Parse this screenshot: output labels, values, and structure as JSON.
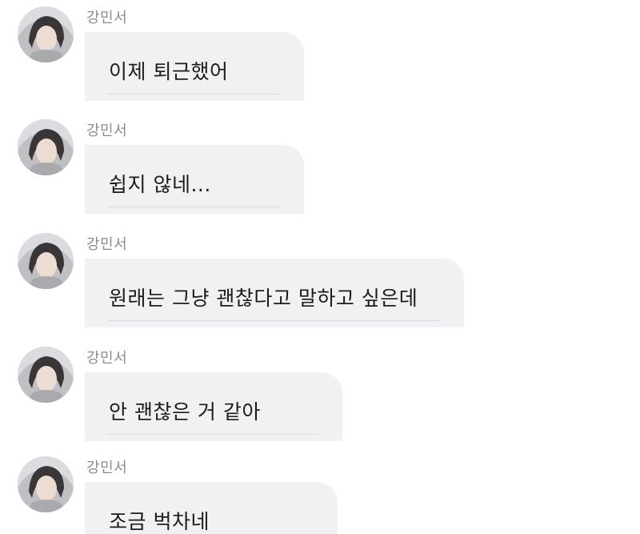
{
  "messages": [
    {
      "sender": "강민서",
      "text": "이제 퇴근했어"
    },
    {
      "sender": "강민서",
      "text": "쉽지 않네..."
    },
    {
      "sender": "강민서",
      "text": "원래는 그냥 괜찮다고 말하고 싶은데"
    },
    {
      "sender": "강민서",
      "text": "안 괜찮은 거 같아"
    },
    {
      "sender": "강민서",
      "text": "조금 벅차네"
    }
  ],
  "colors": {
    "background": "#ffffff",
    "bubble": "#f1f1f3",
    "sender_name": "#8b8b90",
    "message_text": "#1c1c1e"
  }
}
